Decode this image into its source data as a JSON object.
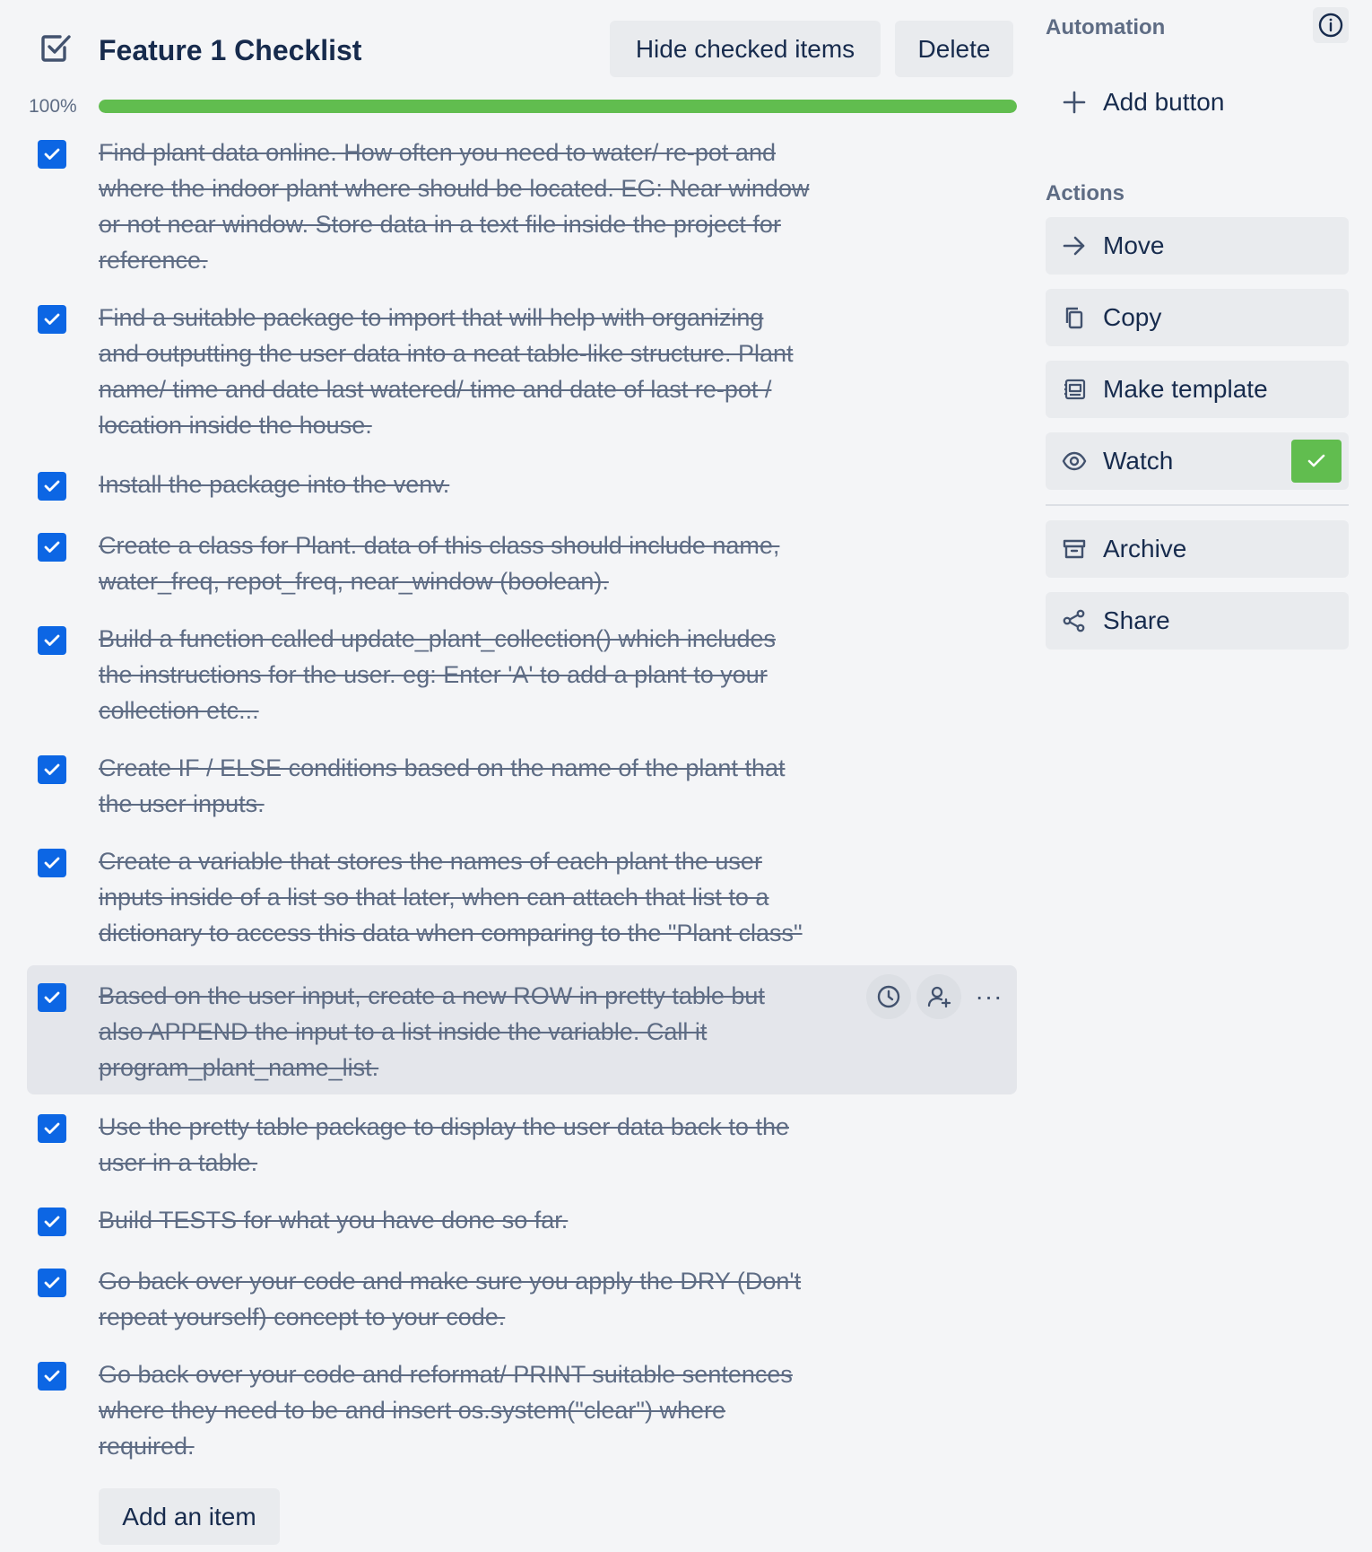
{
  "checklist": {
    "title": "Feature 1 Checklist",
    "hide_checked_label": "Hide checked items",
    "delete_label": "Delete",
    "progress_text": "100%",
    "progress_fraction": 1.0,
    "items": [
      {
        "text": "Find plant data online. How often you need to water/ re-pot and\nwhere the indoor plant where should be located. EG: Near window\nor not near window. Store data in a text file inside the project for\nreference.",
        "checked": true
      },
      {
        "text": "Find a suitable package to import that will help with organizing\nand outputting the user data into a neat table-like structure. Plant\nname/ time and date last watered/ time and date of last re-pot /\nlocation inside the house.",
        "checked": true
      },
      {
        "text": "Install the package into the venv.",
        "checked": true
      },
      {
        "text": "Create a class for Plant. data of this class should include name,\nwater_freq, repot_freq, near_window (boolean).",
        "checked": true
      },
      {
        "text": "Build a function called update_plant_collection() which includes\nthe instructions for the user. eg: Enter 'A' to add a plant to your\ncollection etc...",
        "checked": true
      },
      {
        "text": "Create IF / ELSE conditions based on the name of the plant that\nthe user inputs.",
        "checked": true
      },
      {
        "text": "Create a variable that stores the names of each plant the user\ninputs inside of a list so that later, when can attach that list to a\ndictionary to access this data when comparing to the \"Plant class\"",
        "checked": true
      },
      {
        "text": "Based on the user input, create a new ROW in pretty table but\nalso APPEND the input to a list inside the variable. Call it\nprogram_plant_name_list.",
        "checked": true
      },
      {
        "text": "Use the pretty table package to display the user data back to the\nuser in a table.",
        "checked": true
      },
      {
        "text": "Build TESTS for what you have done so far.",
        "checked": true
      },
      {
        "text": "Go back over your code and make sure you apply the DRY (Don't\nrepeat yourself) concept to your code.",
        "checked": true
      },
      {
        "text": "Go back over your code and reformat/ PRINT suitable sentences\nwhere they need to be and insert os.system(\"clear\") where\nrequired.",
        "checked": true
      }
    ],
    "item_actions": {
      "due_icon": "clock-icon",
      "assign_icon": "assign-member-icon",
      "more_icon": "more-icon",
      "more_glyph": "···"
    },
    "add_item_label": "Add an item",
    "colors": {
      "progress_fill": "#61bd4f",
      "checkbox": "#0c66e4",
      "background": "#f4f5f7"
    }
  },
  "sidebar": {
    "automation_heading": "Automation",
    "add_button_label": "Add button",
    "actions_heading": "Actions",
    "actions": [
      {
        "label": "Move",
        "icon": "arrow-right-icon"
      },
      {
        "label": "Copy",
        "icon": "copy-icon"
      },
      {
        "label": "Make template",
        "icon": "template-icon"
      },
      {
        "label": "Watch",
        "icon": "eye-icon",
        "active": true
      },
      {
        "label": "Archive",
        "icon": "archive-icon"
      },
      {
        "label": "Share",
        "icon": "share-icon"
      }
    ]
  }
}
